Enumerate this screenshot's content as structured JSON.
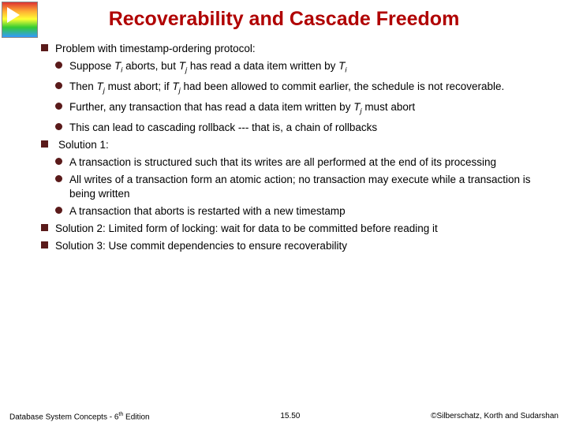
{
  "title": "Recoverability and Cascade Freedom",
  "b1": {
    "problem": "Problem with timestamp-ordering protocol:",
    "sol1": "Solution 1:",
    "sol2": "Solution 2: Limited form of locking: wait for data to be committed before reading it",
    "sol3": "Solution 3: Use commit dependencies to ensure recoverability"
  },
  "p": {
    "a_pre": "Suppose ",
    "a_mid1": " aborts, but ",
    "a_mid2": " has read a data item written by  ",
    "b_pre": "Then ",
    "b_mid1": " must abort; if ",
    "b_mid2": " had been allowed to commit earlier, the schedule is not recoverable.",
    "c_pre": "Further, any transaction that has read a data item written by ",
    "c_post": " must abort",
    "d": "This can lead to cascading rollback --- that is, a chain of rollbacks"
  },
  "s": {
    "a": "A transaction is structured such that its writes are all performed at the end of its processing",
    "b": "All writes of a transaction form an atomic action; no transaction may execute while a transaction is being written",
    "c": "A transaction that aborts is restarted with a new timestamp"
  },
  "sym": {
    "T": "T",
    "i": "i",
    "j": "j"
  },
  "footer": {
    "left_a": "Database System Concepts - 6",
    "left_b": " Edition",
    "th": "th",
    "center": "15.50",
    "right": "©Silberschatz, Korth and Sudarshan"
  }
}
